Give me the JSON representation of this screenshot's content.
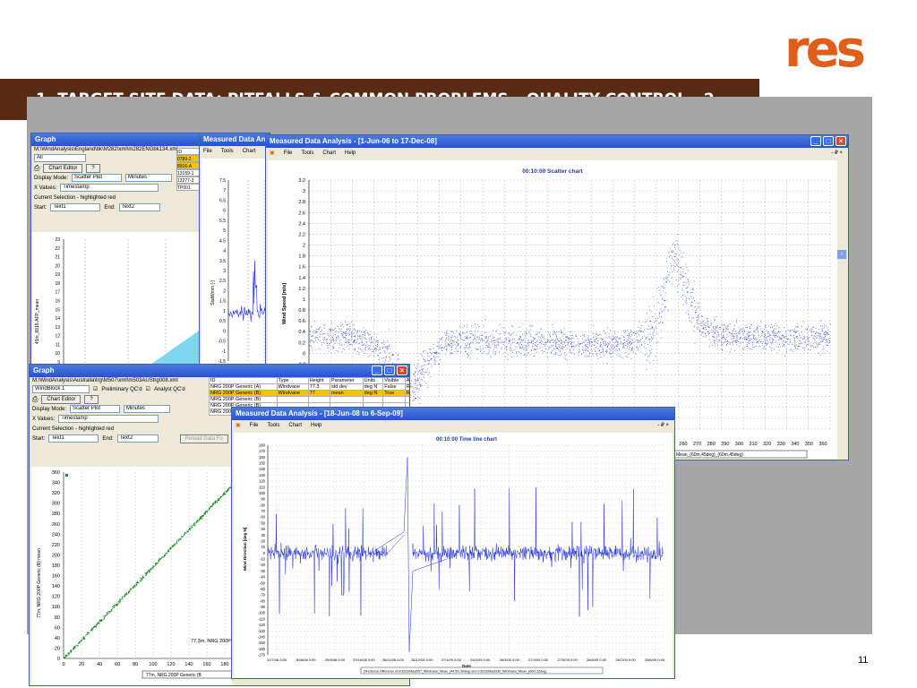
{
  "slide": {
    "title": "1.   TARGET SITE DATA: PITFALLS & COMMON PROBLEMS – QUALITY CONTROL - 2",
    "page_number": "11",
    "logo_text": "res",
    "brand_color": "#e05d1a",
    "title_bar_color": "#5a2b12"
  },
  "win_graph1": {
    "title": "Graph",
    "path": "M:\\WindAnalysis\\England\\bk\\M282\\xml\\m282ENGbk134.xml",
    "filter_value": "All",
    "chart_editor_label": "Chart Editor",
    "help_label": "?",
    "display_mode_label": "Display Mode:",
    "display_mode_value": "Scatter Plot",
    "units_value": "Minutes",
    "xvalues_label": "X Values:",
    "xvalues_value": "Timestamp",
    "selection_label": "Current Selection - highlighted red",
    "start_label": "Start:",
    "start_value": "Text1",
    "end_label": "End:",
    "end_value": "Text2",
    "side_list": [
      "ID",
      "0789-2",
      "8916-A",
      "13159-1",
      "13277-3",
      "TP001"
    ],
    "ylabel": "45m_8915-AFP_mean",
    "yticks": [
      "23",
      "22",
      "21",
      "20",
      "19",
      "18",
      "17",
      "16",
      "15",
      "14",
      "13",
      "12",
      "11",
      "10",
      "9"
    ]
  },
  "win_mda_back": {
    "title": "Measured Data Analysis",
    "menu": [
      "File",
      "Tools",
      "Chart"
    ],
    "ylabel": "StatWmm [-]",
    "yticks": [
      "7.5",
      "7",
      "6.5",
      "6",
      "5.5",
      "5",
      "4.5",
      "4",
      "3.5",
      "3",
      "2.5",
      "2",
      "1.5",
      "1",
      "0.5",
      "0",
      "-0.5",
      "-1",
      "-1.5"
    ]
  },
  "win_mda_main": {
    "title": "Measured Data Analysis - [1-Jun-06 to 17-Dec-08]",
    "menu": [
      "File",
      "Tools",
      "Chart",
      "Help"
    ],
    "menu_right": "- ₽ ×",
    "chart_title": "00:10:00 Scatter chart",
    "ylabel": "Wind Speed [m/s]",
    "legend": "Mean_(60m,45deg)_(60m,45deg)"
  },
  "win_graph2": {
    "title": "Graph",
    "path": "M:\\WindAnalysis\\Australia\\trg\\M507\\xml\\m503AUStrg008.xml",
    "filter_value": "WindBlock 1",
    "chk1_label": "Preliminary QC'd",
    "chk2_label": "Analyst QC'd",
    "chart_editor_label": "Chart Editor",
    "help_label": "?",
    "display_mode_label": "Display Mode:",
    "display_mode_value": "Scatter Plot",
    "units_value": "Minutes",
    "xvalues_label": "X Values:",
    "xvalues_value": "Timestamp",
    "selection_label": "Current Selection - highlighted red",
    "start_label": "Start:",
    "start_value": "Text1",
    "end_label": "End:",
    "end_value": "Text2",
    "reload_label": "Reload Data Fo",
    "table_headers": [
      "ID",
      "Type",
      "Height",
      "Parameter",
      "Units",
      "Visible",
      "Axis"
    ],
    "table_rows": [
      [
        "NRG 200P Generic (A)",
        "Windvane",
        "77.3",
        "std dev",
        "deg N",
        "False",
        "Right"
      ],
      [
        "NRG 200P Generic (B)",
        "Windvane",
        "77",
        "mean",
        "deg N",
        "True",
        "Right"
      ],
      [
        "NRG 200P Generic (B)",
        "",
        "",
        "",
        "",
        "",
        ""
      ],
      [
        "NRG 200P Generic (B)",
        "",
        "",
        "",
        "",
        "",
        ""
      ],
      [
        "NRG 200P Generic (B)",
        "",
        "",
        "",
        "",
        "",
        ""
      ]
    ],
    "ylabel": "77m, NRG 200P Generic (B) mean",
    "xlabel_partial": "77.3m, NRG 200P G",
    "legend": "77m, NRG 200P Generic (B"
  },
  "win_mda_time": {
    "title": "Measured Data Analysis - [18-Jun-08 to 6-Sep-09]",
    "menu": [
      "File",
      "Tools",
      "Chart",
      "Help"
    ],
    "menu_right": "- ₽ ×",
    "chart_title": "00:10:00 Time line chart",
    "ylabel": "Wind Direction [deg N]",
    "xlabel": "Date",
    "legend": "Directional Difference of m3033/Mast057_Windvane_Mean_(44.5m,90deg) and m3033/Mast030_Windvane_Mean_(60m,32deg)"
  },
  "chart_data": [
    {
      "type": "scatter",
      "title": "00:10:00 Scatter chart",
      "ylabel": "Wind Speed [m/s]",
      "yticks": [
        3.2,
        3,
        2.8,
        2.6,
        2.4,
        2.2,
        2,
        1.8,
        1.6,
        1.4,
        1.2,
        1,
        0.8,
        0.6,
        0.4,
        0.2,
        0,
        -0.2,
        -0.4,
        -0.6,
        -0.8,
        -1,
        -1.2,
        -1.4
      ],
      "xticks": [
        260,
        270,
        280,
        290,
        300,
        310,
        320,
        330,
        340,
        350,
        360
      ],
      "ylim": [
        -1.4,
        3.2
      ],
      "grid": true,
      "series_color": "#1f2fd6",
      "trend_x": [
        0.0,
        0.06,
        0.12,
        0.16,
        0.19,
        0.22,
        0.26,
        0.32,
        0.45,
        0.55,
        0.62,
        0.66,
        0.68,
        0.7,
        0.72,
        0.75,
        0.8,
        0.9,
        1.0
      ],
      "trend_y": [
        0.3,
        0.35,
        0.2,
        -0.2,
        -0.8,
        -0.3,
        0.2,
        0.25,
        0.2,
        0.15,
        0.2,
        0.4,
        1.0,
        1.9,
        1.3,
        0.5,
        0.3,
        0.3,
        0.3
      ]
    },
    {
      "type": "line",
      "title": "00:10:00 Time line chart",
      "ylabel": "Wind Direction [deg N]",
      "xlabel": "Date",
      "yticks": [
        180,
        170,
        160,
        150,
        140,
        130,
        120,
        110,
        100,
        90,
        80,
        70,
        60,
        50,
        40,
        30,
        20,
        10,
        0,
        -10,
        -20,
        -30,
        -40,
        -50,
        -60,
        -70,
        -80,
        -90,
        -100,
        -110,
        -120,
        -130,
        -140,
        -150,
        -160,
        -170
      ],
      "xticks": [
        "31/7/08 0:00",
        "30/8/08 0:00",
        "29/9/08 0:00",
        "29/10/08 0:00",
        "28/11/08 0:00",
        "28/12/08 0:00",
        "27/1/09 0:00",
        "26/2/09 0:00",
        "28/3/09 0:00",
        "27/4/09 0:00",
        "27/5/09 0:00",
        "26/6/09 0:00",
        "26/7/09 0:00",
        "25/8/09 0:00"
      ],
      "ylim": [
        -170,
        180
      ],
      "grid": true,
      "series_color": "#1f2fd6"
    },
    {
      "type": "scatter",
      "ylabel": "77m, NRG 200P Generic (B) mean",
      "yticks": [
        360,
        340,
        320,
        300,
        280,
        260,
        240,
        220,
        200,
        180,
        160,
        140,
        120,
        100,
        80,
        60,
        40,
        20,
        0
      ],
      "xticks": [
        0,
        20,
        40,
        60,
        80,
        100,
        120,
        140,
        160,
        180
      ],
      "ylim": [
        0,
        360
      ],
      "series_color": "#1a8a2a"
    }
  ]
}
